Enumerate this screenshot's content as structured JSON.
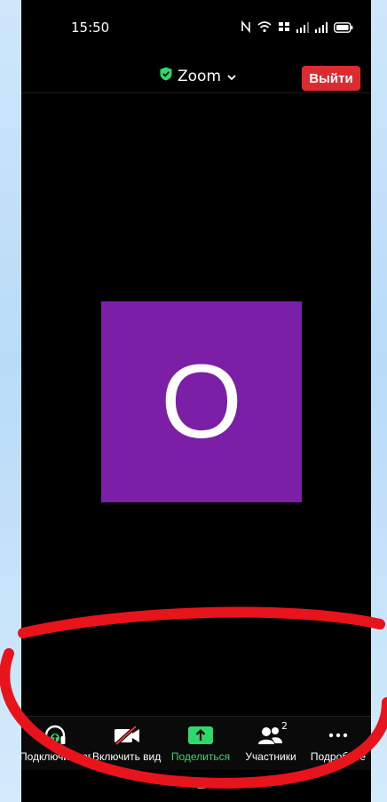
{
  "status_bar": {
    "time": "15:50",
    "icons": [
      "nfc-icon",
      "wifi-icon",
      "lte-icon",
      "signal-icon",
      "signal-icon",
      "battery-icon"
    ]
  },
  "header": {
    "title": "Zoom",
    "shield_color": "#2fd86a",
    "leave_label": "Выйти",
    "leave_color": "#dc2b31"
  },
  "participant": {
    "initial": "O",
    "tile_color": "#7b20a6"
  },
  "toolbar": {
    "audio_label": "Подключить звук",
    "video_label": "Включить видео",
    "share_label": "Поделиться",
    "participants_label": "Участники",
    "participants_count": "2",
    "more_label": "Подробнее",
    "accent_color": "#2fd86a"
  }
}
